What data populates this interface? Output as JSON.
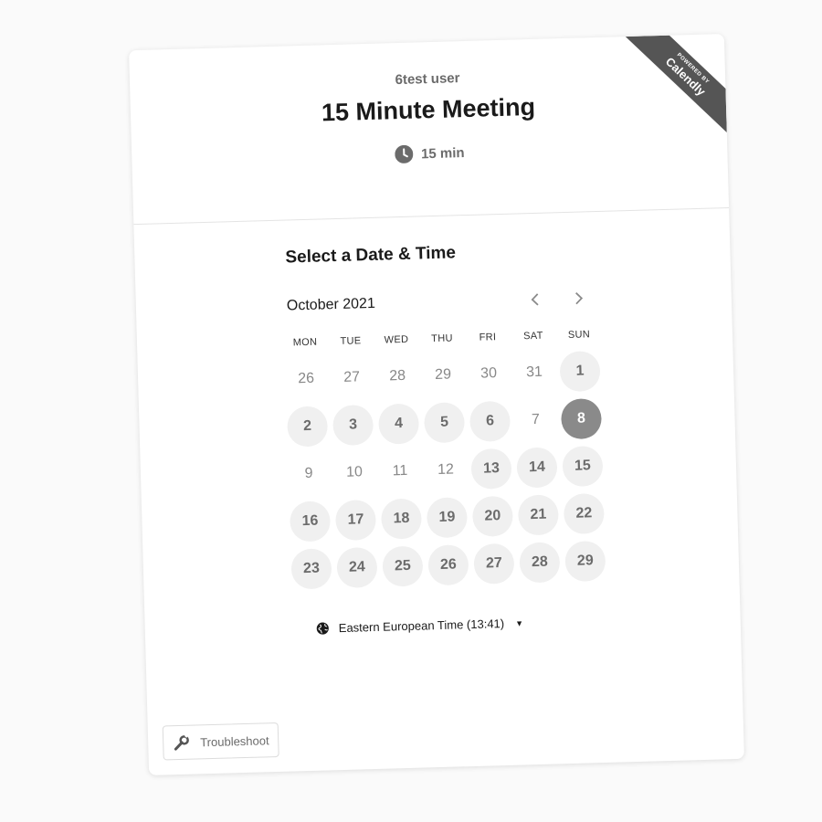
{
  "ribbon": {
    "powered_by": "POWERED BY",
    "brand": "Calendly"
  },
  "event": {
    "host": "6test user",
    "title": "15 Minute Meeting",
    "duration": "15 min",
    "duration_icon": "clock-icon"
  },
  "booking": {
    "section_title": "Select a Date & Time",
    "month_label": "October 2021",
    "prev_icon": "chevron-left-icon",
    "next_icon": "chevron-right-icon",
    "weekdays": [
      "MON",
      "TUE",
      "WED",
      "THU",
      "FRI",
      "SAT",
      "SUN"
    ],
    "weeks": [
      [
        {
          "d": "26",
          "s": "unavail"
        },
        {
          "d": "27",
          "s": "unavail"
        },
        {
          "d": "28",
          "s": "unavail"
        },
        {
          "d": "29",
          "s": "unavail"
        },
        {
          "d": "30",
          "s": "unavail"
        },
        {
          "d": "31",
          "s": "unavail"
        },
        {
          "d": "1",
          "s": "avail"
        }
      ],
      [
        {
          "d": "2",
          "s": "avail"
        },
        {
          "d": "3",
          "s": "avail"
        },
        {
          "d": "4",
          "s": "avail"
        },
        {
          "d": "5",
          "s": "avail"
        },
        {
          "d": "6",
          "s": "avail"
        },
        {
          "d": "7",
          "s": "unavail"
        },
        {
          "d": "8",
          "s": "selected"
        }
      ],
      [
        {
          "d": "9",
          "s": "unavail"
        },
        {
          "d": "10",
          "s": "unavail"
        },
        {
          "d": "11",
          "s": "unavail"
        },
        {
          "d": "12",
          "s": "unavail"
        },
        {
          "d": "13",
          "s": "avail"
        },
        {
          "d": "14",
          "s": "avail"
        },
        {
          "d": "15",
          "s": "avail"
        }
      ],
      [
        {
          "d": "16",
          "s": "avail"
        },
        {
          "d": "17",
          "s": "avail"
        },
        {
          "d": "18",
          "s": "avail"
        },
        {
          "d": "19",
          "s": "avail"
        },
        {
          "d": "20",
          "s": "avail"
        },
        {
          "d": "21",
          "s": "avail"
        },
        {
          "d": "22",
          "s": "avail"
        }
      ],
      [
        {
          "d": "23",
          "s": "avail"
        },
        {
          "d": "24",
          "s": "avail"
        },
        {
          "d": "25",
          "s": "avail"
        },
        {
          "d": "26",
          "s": "avail"
        },
        {
          "d": "27",
          "s": "avail"
        },
        {
          "d": "28",
          "s": "avail"
        },
        {
          "d": "29",
          "s": "avail"
        }
      ]
    ],
    "timezone": "Eastern European Time (13:41)",
    "timezone_icon": "globe-icon"
  },
  "footer": {
    "troubleshoot_label": "Troubleshoot",
    "troubleshoot_icon": "wrench-icon"
  },
  "colors": {
    "selected": "#8a8a8a",
    "available_bg": "#f0f0f0",
    "ribbon": "#555555"
  }
}
